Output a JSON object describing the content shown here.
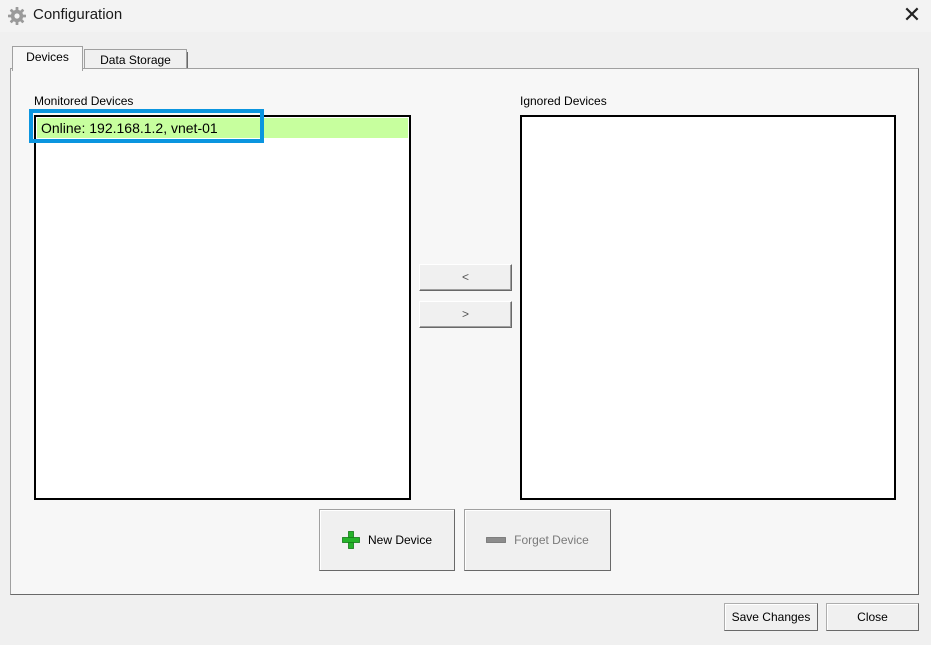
{
  "window": {
    "title": "Configuration",
    "icon": "gear-icon",
    "close_icon": "close-icon",
    "close_glyph": "✕"
  },
  "tabs": [
    {
      "label": "Devices",
      "active": true
    },
    {
      "label": "Data Storage",
      "active": false
    }
  ],
  "monitored": {
    "label": "Monitored Devices",
    "items": [
      "Online:  192.168.1.2, vnet-01"
    ]
  },
  "ignored": {
    "label": "Ignored Devices",
    "items": []
  },
  "transfer": {
    "left_label": "<",
    "right_label": ">"
  },
  "actions": {
    "new_device": {
      "label": "New Device",
      "icon": "plus-icon"
    },
    "forget_device": {
      "label": "Forget Device",
      "icon": "minus-icon",
      "disabled": true
    }
  },
  "footer": {
    "save_label": "Save Changes",
    "close_label": "Close"
  },
  "colors": {
    "online_row": "#c7ff9e",
    "highlight": "#0b95df",
    "plus_icon": "#25b32a"
  }
}
